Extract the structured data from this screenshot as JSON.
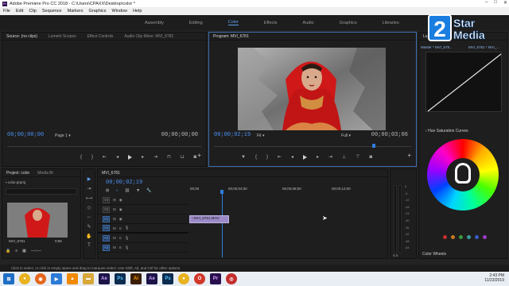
{
  "app": {
    "title": "Adobe Premiere Pro CC 2018 - C:\\Users\\CPAXX\\Desktop\\color *",
    "logo_text": "Pr"
  },
  "menu": [
    "File",
    "Edit",
    "Clip",
    "Sequence",
    "Markers",
    "Graphics",
    "Window",
    "Help"
  ],
  "workspaces": {
    "items": [
      "Assembly",
      "Editing",
      "Color",
      "Effects",
      "Audio",
      "Graphics",
      "Libraries"
    ],
    "active": "Color"
  },
  "source": {
    "tabs": [
      "Source: (no clips)",
      "Lumetri Scopes",
      "Effect Controls",
      "Audio Clip Mixer: MVI_6781"
    ],
    "timecode_left": "00;00;00;00",
    "timecode_right": "00;00;00;00",
    "page": "Page 1"
  },
  "program": {
    "tab": "Program: MVI_6781",
    "timecode_left": "00;00;02;19",
    "fit": "Fit",
    "quality": "Full",
    "timecode_right": "00;00;03;06"
  },
  "lumetri": {
    "tab": "Lu",
    "master": "Master * MVI_678...",
    "clip": "MVI_6781 * MVI_...",
    "hsl_label": "Hue Saturation Curves",
    "color_wheels": "Color Wheels"
  },
  "watermark": {
    "number": "2",
    "line1": "Star",
    "line2": "Media"
  },
  "project": {
    "tabs": [
      "Project: color",
      "Media Br"
    ],
    "file": "color.prproj",
    "thumb_name": "MVI_6781",
    "thumb_dur": "0;86"
  },
  "timeline": {
    "tab": "MVI_6781",
    "timecode": "00;00;02;19",
    "ruler": [
      "00;00",
      "00;00;04;00",
      "00;00;08;00",
      "00;00;12;00"
    ],
    "clip_label": "MVI_6781.MOV",
    "video_tracks": [
      "V3",
      "V2",
      "V1"
    ],
    "audio_tracks": [
      "A1",
      "A2",
      "A3"
    ],
    "meter_scale": [
      "0",
      "-6",
      "-12",
      "-18",
      "-24",
      "-30",
      "-36",
      "-42",
      "-48",
      "-54"
    ],
    "meter_foot": "S S"
  },
  "status": "Click to select, or click in empty space and drag to marquee select. Use Shift, Alt, and Ctrl for other options.",
  "clock": {
    "time": "2:43 PM",
    "date": "11/23/2019"
  },
  "taskbar_icons": [
    {
      "icon": "windows-start-icon",
      "color": "#1f6fc4"
    },
    {
      "icon": "chrome-icon",
      "color": "#e8b320"
    },
    {
      "icon": "firefox-icon",
      "color": "#e5671c"
    },
    {
      "icon": "media-player-icon",
      "color": "#2c7bd6"
    },
    {
      "icon": "vlc-icon",
      "color": "#f18a00"
    },
    {
      "icon": "folder-icon",
      "color": "#d9a83a"
    },
    {
      "icon": "after-effects-icon",
      "color": "#1c1447"
    },
    {
      "icon": "photoshop-icon",
      "color": "#0b2c4f"
    },
    {
      "icon": "illustrator-icon",
      "color": "#3b1d05"
    }
  ],
  "colors": {
    "accent": "#4b8ff0",
    "panel": "#1e1e1e",
    "dress": "#d01818"
  }
}
